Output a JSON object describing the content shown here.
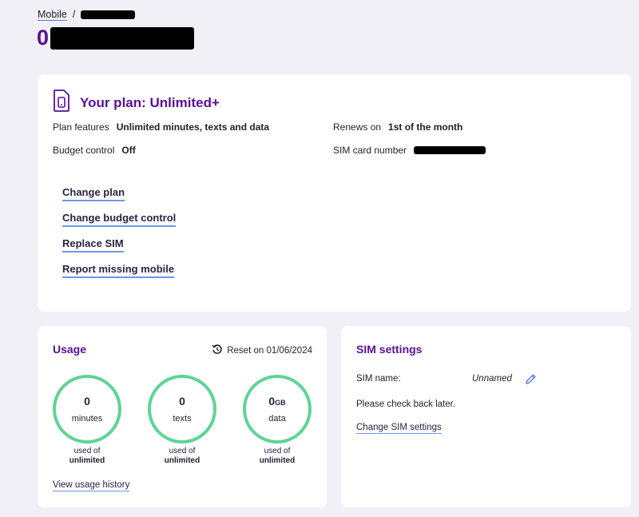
{
  "breadcrumb": {
    "root": "Mobile",
    "separator": "/"
  },
  "page": {
    "title_prefix": "0"
  },
  "plan": {
    "title": "Your plan: Unlimited+",
    "features_label": "Plan features",
    "features_value": "Unlimited minutes, texts and data",
    "renews_label": "Renews on",
    "renews_value": "1st of the month",
    "budget_label": "Budget control",
    "budget_value": "Off",
    "sim_label": "SIM card number",
    "links": [
      "Change plan",
      "Change budget control",
      "Replace SIM",
      "Report missing mobile"
    ]
  },
  "usage": {
    "title": "Usage",
    "reset_text": "Reset on 01/06/2024",
    "items": [
      {
        "value": "0",
        "unit_suffix": "",
        "unit": "minutes",
        "used_of": "used of",
        "limit": "unlimited"
      },
      {
        "value": "0",
        "unit_suffix": "",
        "unit": "texts",
        "used_of": "used of",
        "limit": "unlimited"
      },
      {
        "value": "0",
        "unit_suffix": "GB",
        "unit": "data",
        "used_of": "used of",
        "limit": "unlimited"
      }
    ],
    "history_link": "View usage history"
  },
  "sim": {
    "title": "SIM settings",
    "name_label": "SIM name:",
    "name_value": "Unnamed",
    "notice": "Please check back later.",
    "change_link": "Change SIM settings"
  },
  "icons": {
    "phone": "phone-icon",
    "history": "history-icon",
    "edit": "pencil-icon"
  },
  "colors": {
    "brand_purple": "#5a0f96",
    "ring_green": "#5fd397",
    "link_underline": "#6f95ea"
  }
}
